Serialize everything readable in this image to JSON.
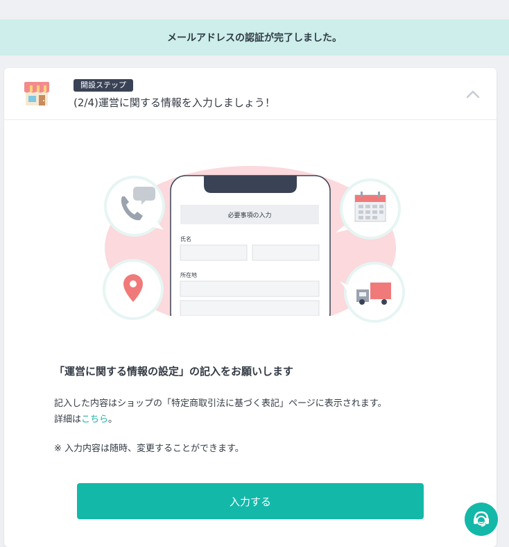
{
  "banner": {
    "message": "メールアドレスの認証が完了しました。"
  },
  "header": {
    "badge": "開設ステップ",
    "title": "(2/4)運営に関する情報を入力しましょう！",
    "collapse_icon": "chevron-up-icon"
  },
  "illustration": {
    "form_header": "必要事項の入力",
    "name_label": "氏名",
    "address_label": "所在地",
    "icons": [
      "phone-icon",
      "location-pin-icon",
      "calendar-icon",
      "truck-icon"
    ]
  },
  "content": {
    "title": "「運営に関する情報の設定」の記入をお願いします",
    "desc_line1": "記入した内容はショップの「特定商取引法に基づく表記」ページに表示されます。",
    "desc_prefix": "詳細は",
    "desc_link": "こちら",
    "desc_suffix": "。",
    "note": "※ 入力内容は随時、変更することができます。"
  },
  "actions": {
    "primary_label": "入力する"
  },
  "colors": {
    "accent": "#13b8a9",
    "banner_bg": "#cdeeea",
    "badge_bg": "#3a4356",
    "illustration_pink": "#fbd9dc",
    "icon_red": "#f07a7a"
  }
}
